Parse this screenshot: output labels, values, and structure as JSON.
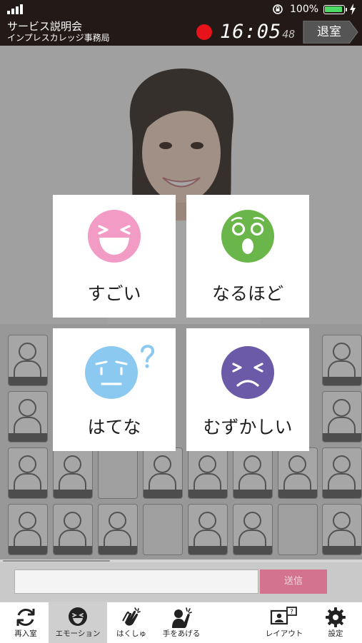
{
  "status_bar": {
    "battery_percent": "100%",
    "battery_level": 1.0,
    "battery_color": "#4cd964"
  },
  "header": {
    "title": "サービス説明会",
    "organizer": "インプレスカレッジ事務局",
    "clock_main": "16:05",
    "clock_seconds": "48",
    "exit_label": "退室",
    "record_color": "#e8121a"
  },
  "emotion_panel": {
    "items": [
      {
        "label": "すごい",
        "icon": "laughing-face-icon",
        "color": "#f29bc4"
      },
      {
        "label": "なるほど",
        "icon": "surprised-face-icon",
        "color": "#6ab64a"
      },
      {
        "label": "はてな",
        "icon": "confused-face-icon",
        "color": "#8cc9f0"
      },
      {
        "label": "むずかしい",
        "icon": "troubled-face-icon",
        "color": "#6b5aa8"
      }
    ]
  },
  "message_bar": {
    "input_value": "",
    "input_placeholder": "",
    "send_label": "送信",
    "send_color": "#d4738f"
  },
  "tab_bar": {
    "rejoin": "再入室",
    "emotion": "エモーション",
    "clap": "はくしゅ",
    "raise_hand": "手をあげる",
    "layout": "レイアウト",
    "layout_badge": "?",
    "settings": "設定",
    "active_tab": "エモーション"
  }
}
